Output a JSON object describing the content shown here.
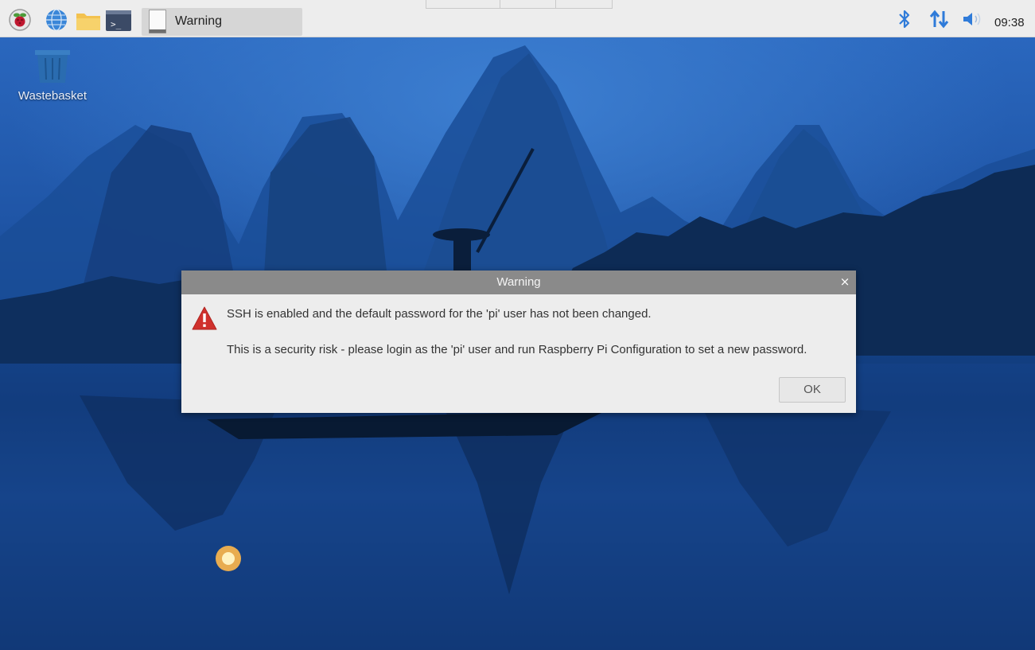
{
  "taskbar": {
    "launchers": [
      {
        "icon": "raspberry-menu-icon"
      },
      {
        "icon": "web-browser-icon"
      },
      {
        "icon": "file-manager-icon"
      },
      {
        "icon": "terminal-icon"
      }
    ],
    "task": {
      "icon": "window-icon",
      "label": "Warning"
    },
    "tray": {
      "bluetooth_icon": "bluetooth-icon",
      "network_icon": "network-updown-icon",
      "volume_icon": "volume-icon",
      "clock": "09:38"
    }
  },
  "desktop": {
    "icons": [
      {
        "icon": "wastebasket-icon",
        "label": "Wastebasket"
      }
    ]
  },
  "dialog": {
    "title": "Warning",
    "close_label": "×",
    "icon": "warning-triangle-icon",
    "message_line1": "SSH is enabled and the default password for the 'pi' user has not been changed.",
    "message_line2": "This is a security risk - please login as the 'pi' user and run Raspberry Pi Configuration to set a new password.",
    "ok_label": "OK"
  },
  "colors": {
    "taskbar_bg": "#ededed",
    "dialog_title_bg": "#8a8a8a",
    "dialog_bg": "#ededed",
    "warning_red": "#d0312d",
    "bluetooth_blue": "#2f7bd9"
  }
}
